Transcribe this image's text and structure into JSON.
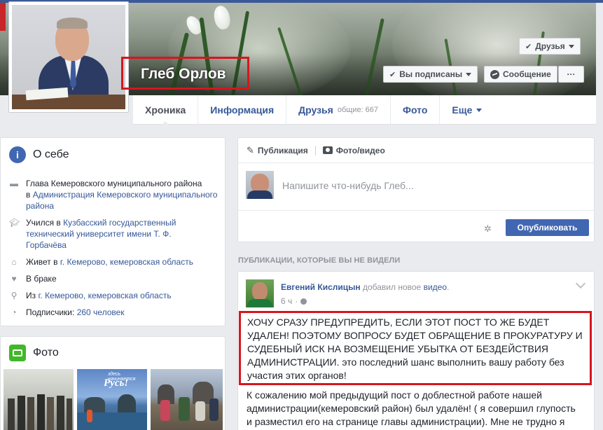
{
  "profile": {
    "name": "Глеб Орлов",
    "friends_button": "Друзья",
    "subscribed_button": "Вы подписаны",
    "message_button": "Сообщение",
    "more_button": "···"
  },
  "nav": {
    "tabs": [
      {
        "label": "Хроника"
      },
      {
        "label": "Информация"
      },
      {
        "label": "Друзья",
        "sub": "общие: 667"
      },
      {
        "label": "Фото"
      },
      {
        "label": "Еще"
      }
    ]
  },
  "about": {
    "title": "О себе",
    "job_prefix": "Глава Кемеровского муниципального района",
    "job_in": "в",
    "job_link": "Администрация Кемеровского муниципального района",
    "study_prefix": "Учился в",
    "study_link": "Кузбасский государственный технический университет имени Т. Ф. Горбачёва",
    "lives_prefix": "Живет в",
    "lives_link": "г. Кемерово, кемеровская область",
    "relationship": "В браке",
    "from_prefix": "Из",
    "from_link": "г. Кемерово, кемеровская область",
    "followers_prefix": "Подписчики:",
    "followers_link": "260 человек"
  },
  "photos": {
    "title": "Фото",
    "photo2_caption": "Русь!",
    "photo2_small": "здесь начинается"
  },
  "composer": {
    "tab_post": "Публикация",
    "tab_photo": "Фото/видео",
    "placeholder": "Напишите что-нибудь Глеб...",
    "publish": "Опубликовать"
  },
  "feed": {
    "section_title": "ПУБЛИКАЦИИ, КОТОРЫЕ ВЫ НЕ ВИДЕЛИ",
    "post": {
      "author": "Евгений Кислицын",
      "action": "добавил новое",
      "action_link": "видео",
      "time": "6 ч",
      "highlight_text": "ХОЧУ СРАЗУ ПРЕДУПРЕДИТЬ, ЕСЛИ ЭТОТ ПОСТ ТО ЖЕ БУДЕТ УДАЛЕН! ПОЭТОМУ ВОПРОСУ БУДЕТ ОБРАЩЕНИЕ В ПРОКУРАТУРУ И СУДЕБНЫЙ ИСК НА ВОЗМЕЩЕНИЕ УБЫТКА ОТ БЕЗДЕЙСТВИЯ АДМИНИСТРАЦИИ. это последний шанс выполнить вашу работу без участия этих органов!",
      "body_text": "К сожалению мой предыдущий пост о доблестной работе нашей администрации(кемеровский район) был удалён! ( я совершил глупость и разместил его на странице главы администрации). Мне не трудно я"
    }
  }
}
